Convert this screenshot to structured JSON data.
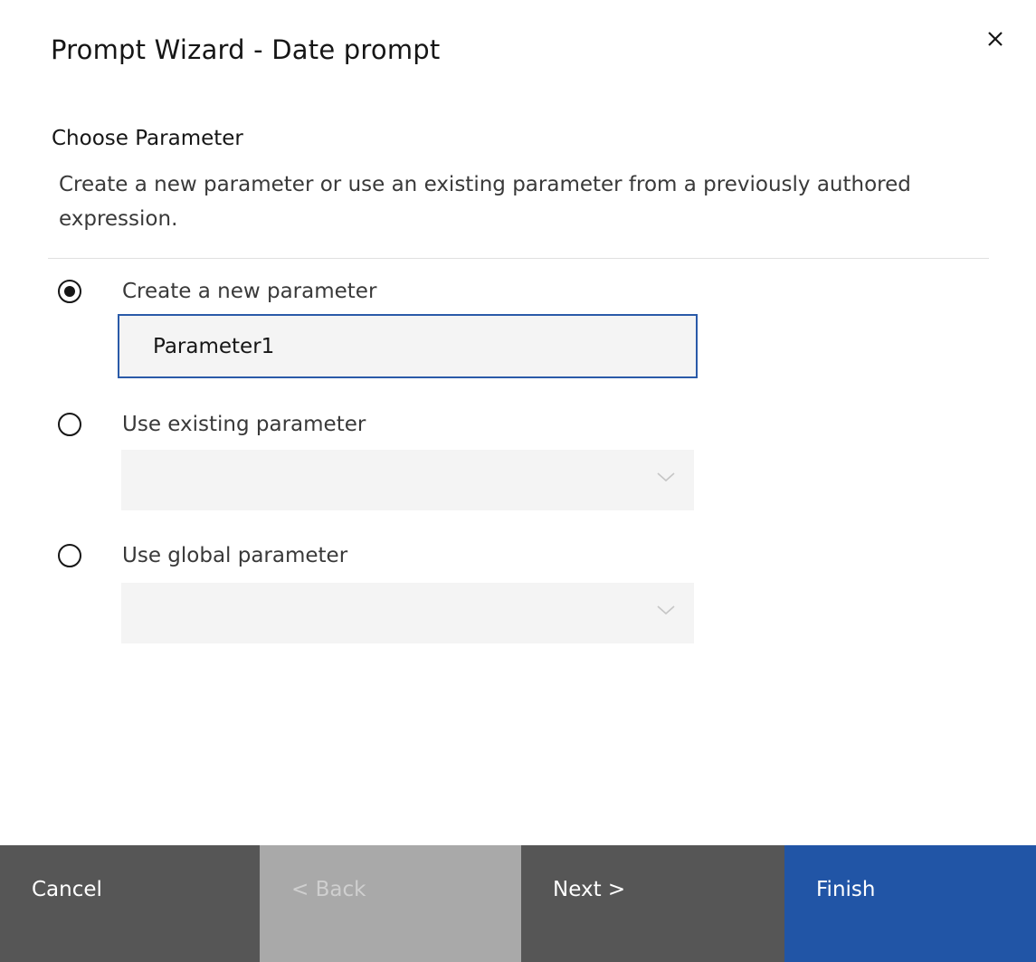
{
  "dialog": {
    "title": "Prompt Wizard - Date prompt"
  },
  "section": {
    "heading": "Choose Parameter",
    "description": "Create a new parameter or use an existing parameter from a previously authored expression."
  },
  "options": [
    {
      "label": "Create a new parameter",
      "selected": true
    },
    {
      "label": "Use existing parameter",
      "selected": false
    },
    {
      "label": "Use global parameter",
      "selected": false
    }
  ],
  "new_parameter": {
    "value": "Parameter1"
  },
  "existing_parameter": {
    "selected_value": ""
  },
  "global_parameter": {
    "selected_value": ""
  },
  "footer": {
    "cancel_label": "Cancel",
    "back_label": "< Back",
    "next_label": "Next >",
    "finish_label": "Finish"
  },
  "colors": {
    "finish_button": "#2155a6",
    "secondary_button": "#565656",
    "disabled_button": "#a9a9a9",
    "input_focus_border": "#2a5aa8",
    "field_background": "#f4f4f4"
  }
}
